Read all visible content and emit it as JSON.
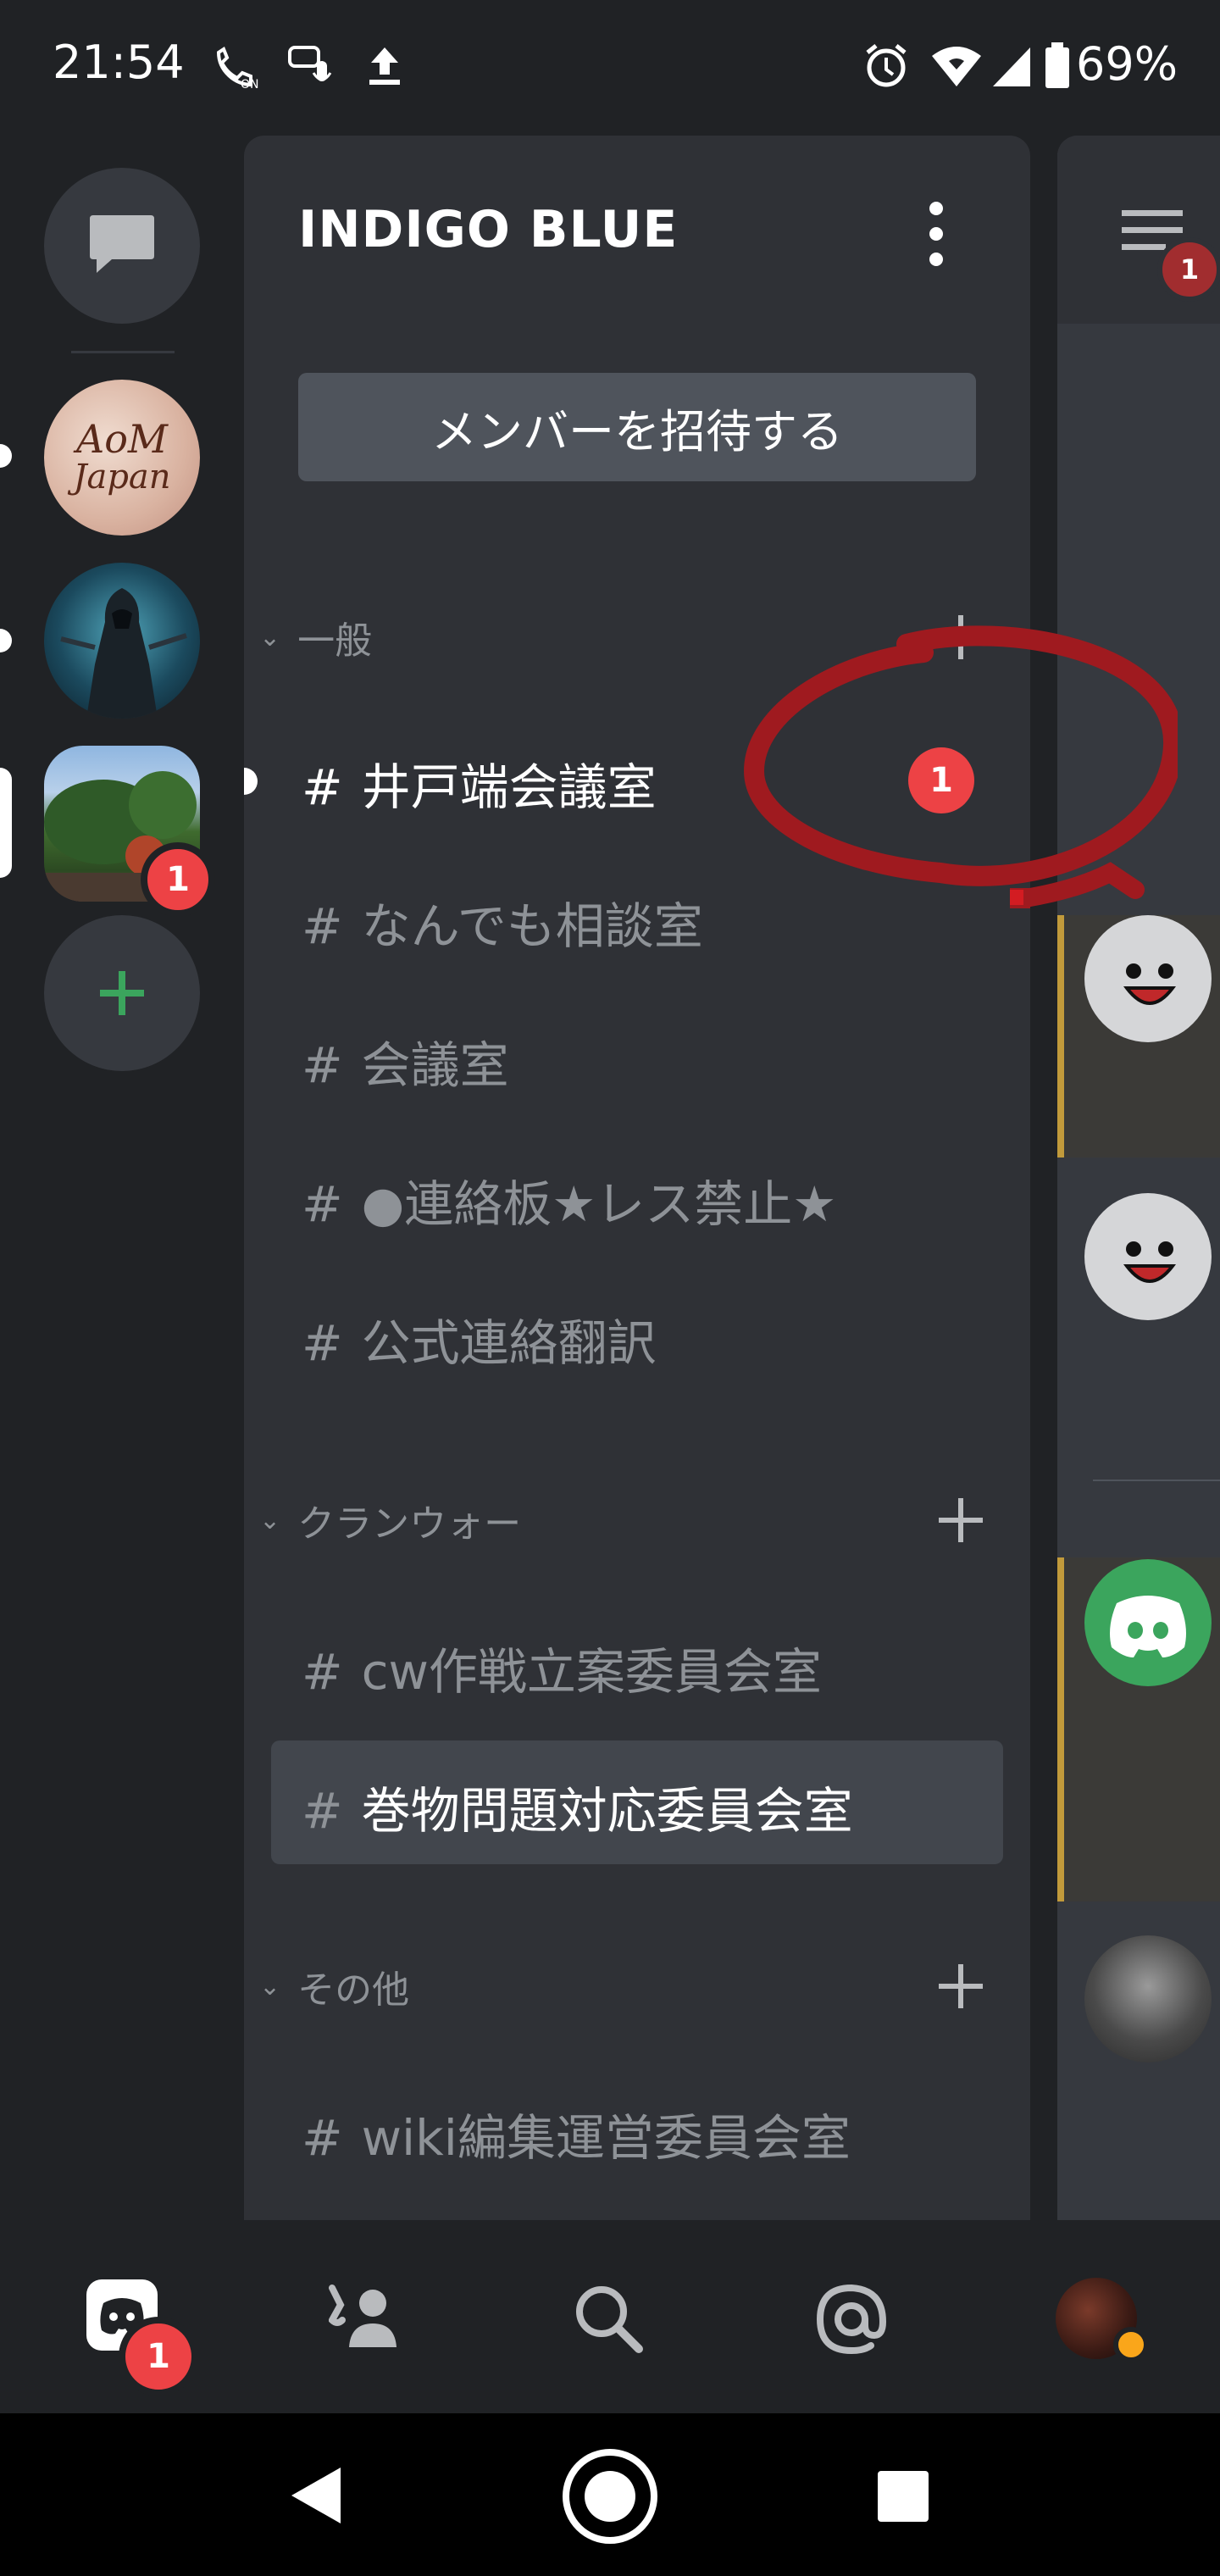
{
  "status_bar": {
    "time": "21:54",
    "battery": "69%",
    "icons": [
      "vowifi-on-icon",
      "voice-message-icon",
      "upload-icon",
      "alarm-icon",
      "wifi-icon",
      "signal-icon",
      "battery-icon"
    ]
  },
  "server_rail": {
    "dm_icon": "chat-bubble-icon",
    "servers": [
      {
        "name": "AoM Japan",
        "avatar_text_line1": "AoM",
        "avatar_text_line2": "Japan"
      },
      {
        "name": "hooded-warrior-server"
      },
      {
        "name": "tree-photo-server",
        "badge": "1"
      }
    ],
    "add_icon": "plus-icon"
  },
  "channel_panel": {
    "server_title": "INDIGO BLUE",
    "invite_label": "メンバーを招待する",
    "categories": [
      {
        "name": "一般",
        "channels": [
          {
            "name": "井戸端会議室",
            "unread": true,
            "badge": "1"
          },
          {
            "name": "なんでも相談室"
          },
          {
            "name": "会議室"
          },
          {
            "name": "●連絡板★レス禁止★"
          },
          {
            "name": "公式連絡翻訳"
          }
        ]
      },
      {
        "name": "クランウォー",
        "channels": [
          {
            "name": "cw作戦立案委員会室"
          },
          {
            "name": "巻物問題対応委員会室",
            "selected": true
          }
        ]
      },
      {
        "name": "その他",
        "channels": [
          {
            "name": "wiki編集運営委員会室"
          }
        ]
      }
    ],
    "hash_symbol": "#"
  },
  "chat_peek": {
    "menu_badge": "1"
  },
  "bottom_nav": {
    "home_badge": "1",
    "items": [
      "discord-home-icon",
      "friends-icon",
      "search-icon",
      "mentions-icon",
      "profile-avatar"
    ]
  },
  "colors": {
    "background": "#202225",
    "panel": "#2f3136",
    "accent_red": "#ed4245",
    "annotation": "#a3151b",
    "add_green": "#3ba55d"
  }
}
